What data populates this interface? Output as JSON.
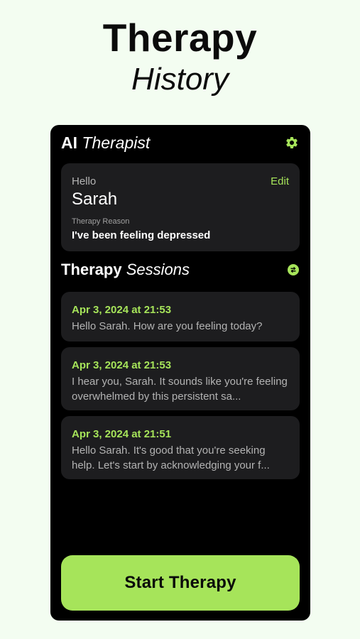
{
  "hero": {
    "line1": "Therapy",
    "line2": "History"
  },
  "header": {
    "title_strong": "AI",
    "title_em": "Therapist",
    "settings_icon": "gear-icon"
  },
  "profile": {
    "greeting": "Hello",
    "name": "Sarah",
    "edit_label": "Edit",
    "reason_label": "Therapy Reason",
    "reason_value": "I've been feeling depressed"
  },
  "sessions": {
    "title_strong": "Therapy",
    "title_em": "Sessions",
    "refresh_icon": "refresh-icon",
    "items": [
      {
        "date": "Apr 3, 2024 at 21:53",
        "preview": "Hello Sarah. How are you feeling today?"
      },
      {
        "date": "Apr 3, 2024 at 21:53",
        "preview": "I hear you, Sarah. It sounds like you're feeling overwhelmed by this persistent sa..."
      },
      {
        "date": "Apr 3, 2024 at 21:51",
        "preview": "Hello Sarah. It's good that you're seeking help. Let's start by acknowledging your f..."
      }
    ]
  },
  "cta": {
    "label": "Start Therapy"
  },
  "colors": {
    "accent": "#a6e45a",
    "card": "#1d1d1f",
    "background": "#f3fdf1",
    "panel": "#000000"
  }
}
